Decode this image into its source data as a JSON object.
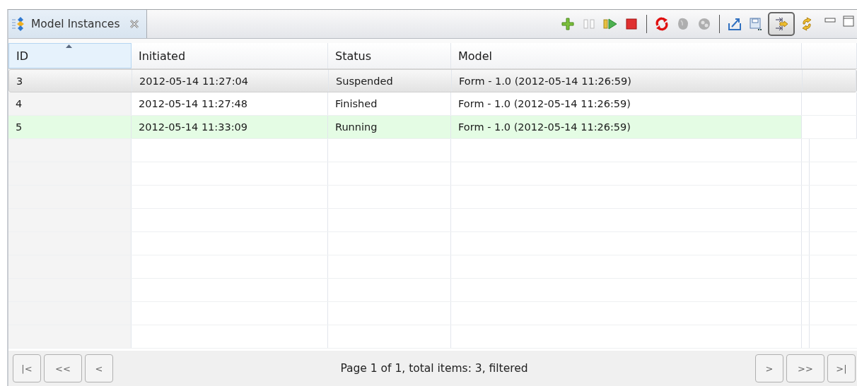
{
  "view_tab": {
    "title": "Model Instances",
    "selected": true
  },
  "toolbar": [
    {
      "kind": "add",
      "disabled": false,
      "checked": false
    },
    {
      "kind": "pause",
      "disabled": true,
      "checked": false
    },
    {
      "kind": "resume",
      "disabled": false,
      "checked": false
    },
    {
      "kind": "stop",
      "disabled": false,
      "checked": false
    },
    {
      "kind": "separator"
    },
    {
      "kind": "refresh",
      "disabled": false,
      "checked": false
    },
    {
      "kind": "blob",
      "disabled": true,
      "checked": false
    },
    {
      "kind": "dice",
      "disabled": true,
      "checked": false
    },
    {
      "kind": "separator"
    },
    {
      "kind": "export",
      "disabled": false,
      "checked": false
    },
    {
      "kind": "save",
      "disabled": false,
      "checked": false
    },
    {
      "kind": "merge",
      "disabled": false,
      "checked": true
    },
    {
      "kind": "sync",
      "disabled": false,
      "checked": false
    }
  ],
  "table": {
    "columns": [
      {
        "label": "ID",
        "sorted": true
      },
      {
        "label": "Initiated",
        "sorted": false
      },
      {
        "label": "Status",
        "sorted": false
      },
      {
        "label": "Model",
        "sorted": false
      }
    ],
    "rows": [
      {
        "cells": [
          "3",
          "2012-05-14 11:27:04",
          "Suspended",
          "Form - 1.0 (2012-05-14 11:26:59)"
        ],
        "selected": true,
        "highlighted": false
      },
      {
        "cells": [
          "4",
          "2012-05-14 11:27:48",
          "Finished",
          "Form - 1.0 (2012-05-14 11:26:59)"
        ],
        "selected": false,
        "highlighted": false
      },
      {
        "cells": [
          "5",
          "2012-05-14 11:33:09",
          "Running",
          "Form - 1.0 (2012-05-14 11:26:59)"
        ],
        "selected": false,
        "highlighted": true
      }
    ]
  },
  "pager": {
    "left_buttons": [
      "|<",
      "<<",
      "<"
    ],
    "status": "Page 1 of 1, total items: 3, filtered",
    "right_buttons": [
      ">",
      ">>",
      ">|"
    ]
  }
}
